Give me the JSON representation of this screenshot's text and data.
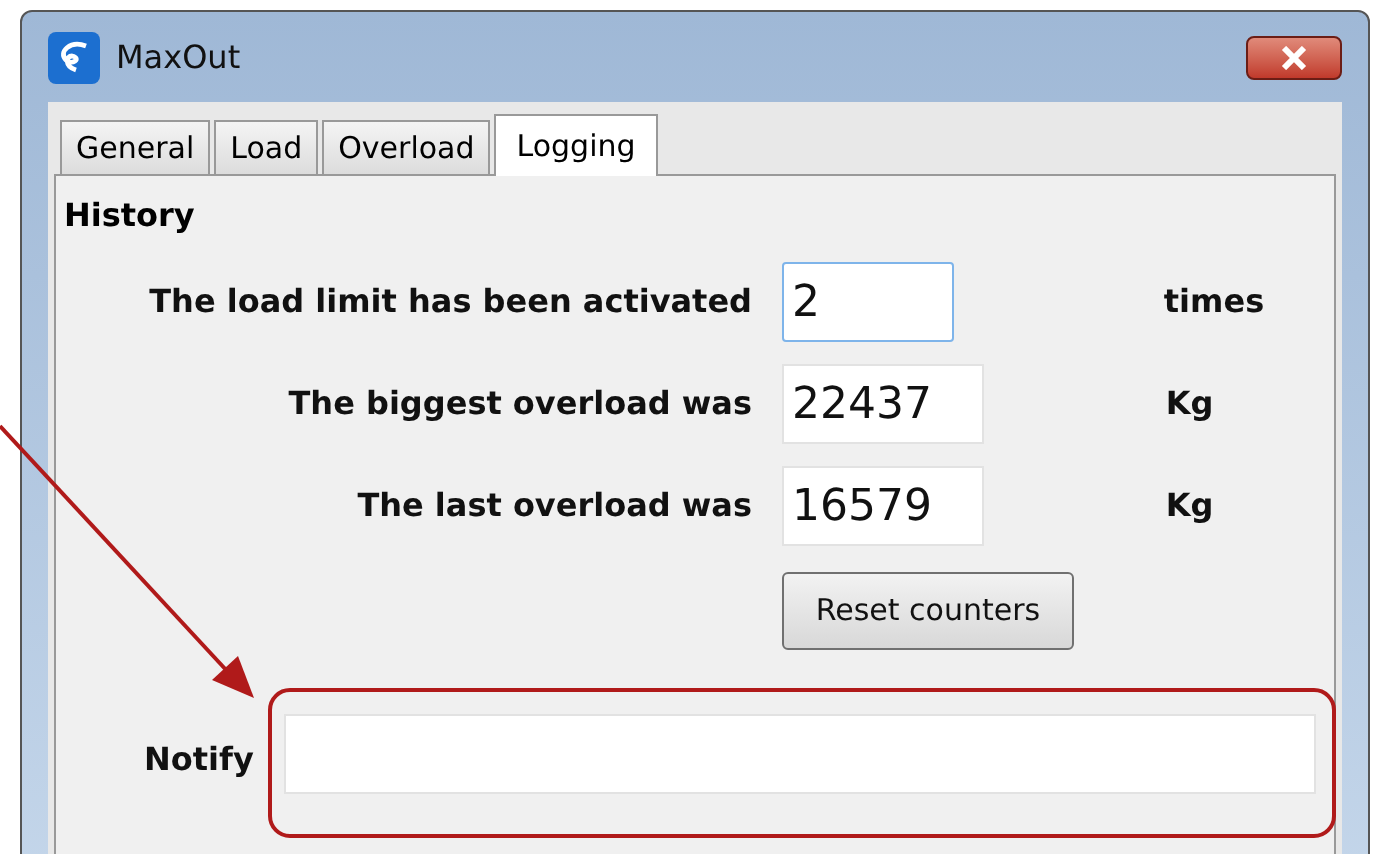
{
  "window": {
    "title": "MaxOut"
  },
  "tabs": [
    {
      "label": "General",
      "selected": false
    },
    {
      "label": "Load",
      "selected": false
    },
    {
      "label": "Overload",
      "selected": false
    },
    {
      "label": "Logging",
      "selected": true
    }
  ],
  "history": {
    "title": "History",
    "rows": [
      {
        "label": "The load limit has been activated",
        "value": "2",
        "unit": "times",
        "focused": true
      },
      {
        "label": "The biggest overload was",
        "value": "22437",
        "unit": "Kg",
        "focused": false
      },
      {
        "label": "The last overload was",
        "value": "16579",
        "unit": "Kg",
        "focused": false
      }
    ]
  },
  "reset_button": "Reset counters",
  "notify": {
    "label": "Notify"
  }
}
